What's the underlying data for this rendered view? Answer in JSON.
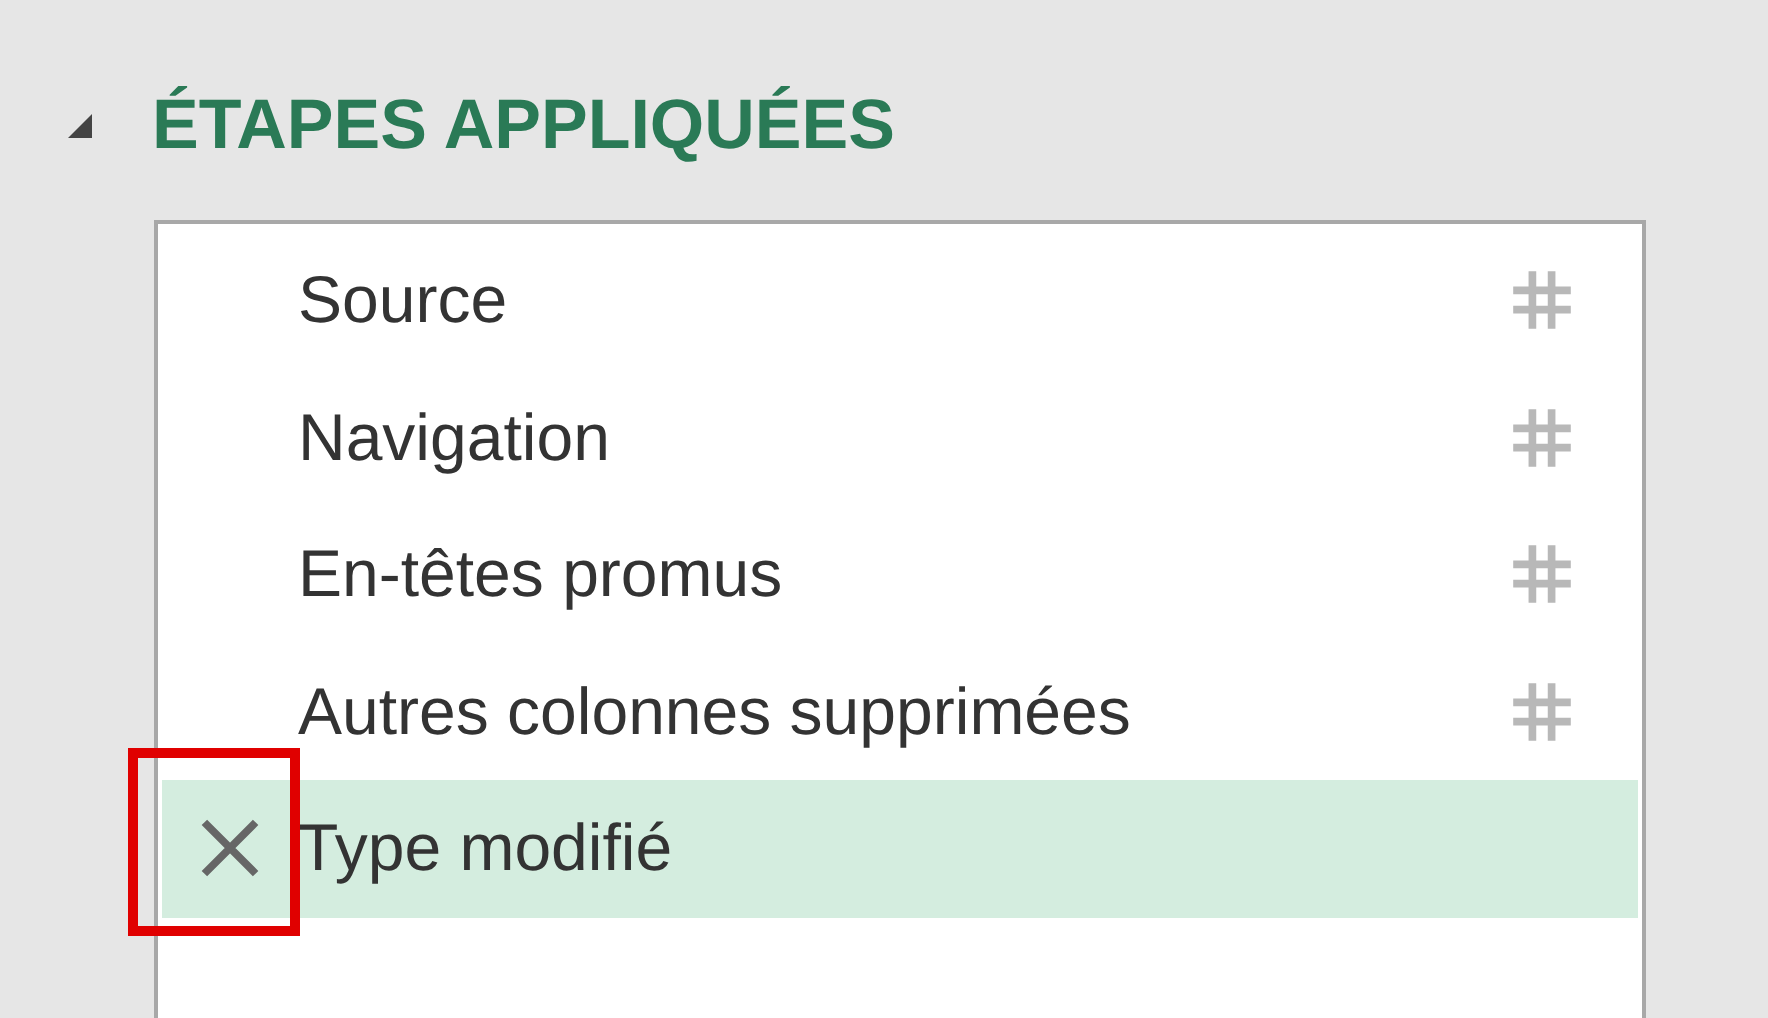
{
  "panel": {
    "title": "ÉTAPES APPLIQUÉES",
    "expanded": true
  },
  "steps": [
    {
      "label": "Source",
      "selected": false,
      "highlighted": false
    },
    {
      "label": "Navigation",
      "selected": false,
      "highlighted": false
    },
    {
      "label": "En-têtes promus",
      "selected": false,
      "highlighted": false
    },
    {
      "label": "Autres colonnes supprimées",
      "selected": false,
      "highlighted": false
    },
    {
      "label": "Type modifié",
      "selected": true,
      "highlighted": true
    }
  ]
}
